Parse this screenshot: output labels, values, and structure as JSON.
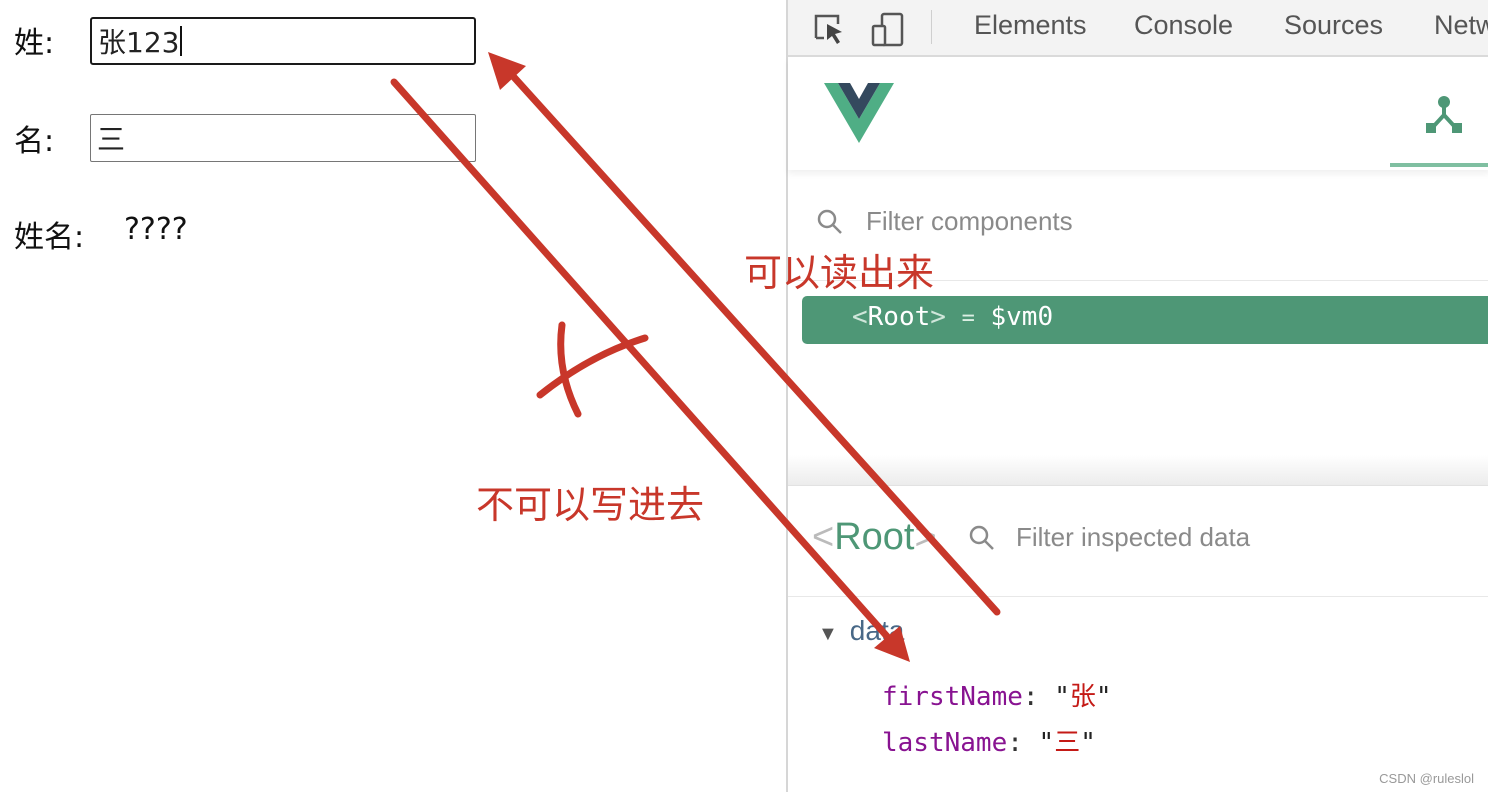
{
  "page": {
    "first_name_label": "姓:",
    "first_name_value": "张123",
    "last_name_label": "名:",
    "last_name_value": "三",
    "full_name_label": "姓名:",
    "full_name_value": "????"
  },
  "devtools": {
    "toolbar": {
      "icons": [
        "inspect-element-icon",
        "device-toolbar-icon"
      ],
      "tabs": [
        "Elements",
        "Console",
        "Sources",
        "Netw"
      ]
    },
    "vue": {
      "logo": "vue-logo",
      "active_tab_icon": "components-tree-icon",
      "filter_components_placeholder": "Filter components",
      "component_tree": [
        {
          "open": "<",
          "name": "Root",
          "close": ">",
          "eq": "=",
          "ref": "$vm0"
        }
      ],
      "inspector": {
        "open": "<",
        "name": "Root",
        "close": ">",
        "filter_placeholder": "Filter inspected data",
        "section": "data",
        "fields": [
          {
            "key": "firstName",
            "value": "张"
          },
          {
            "key": "lastName",
            "value": "三"
          }
        ]
      }
    }
  },
  "annotations": {
    "read_label": "可以读出来",
    "write_label": "不可以写进去",
    "color": "#c8372a"
  },
  "watermark": "CSDN @ruleslol"
}
